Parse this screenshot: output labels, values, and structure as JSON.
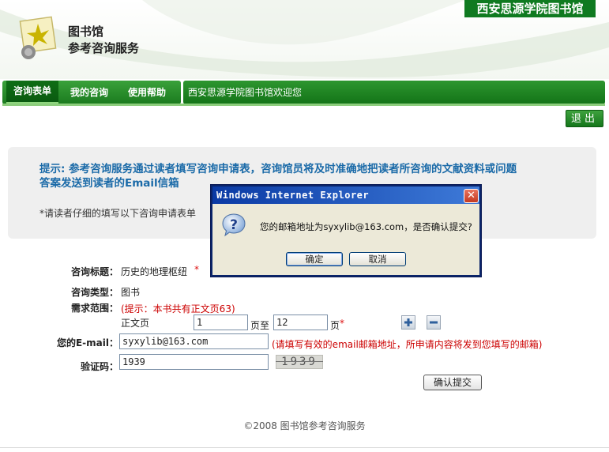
{
  "header": {
    "title": "图书馆",
    "subtitle": "参考咨询服务",
    "site_name": "西安思源学院图书馆"
  },
  "nav": {
    "items": [
      {
        "label": "咨询表单",
        "active": true
      },
      {
        "label": "我的咨询",
        "active": false
      },
      {
        "label": "使用帮助",
        "active": false
      }
    ],
    "welcome": "西安思源学院图书馆欢迎您",
    "logout_label": "退出"
  },
  "tip": {
    "line1": "提示: 参考咨询服务通过读者填写咨询申请表，咨询馆员将及时准确地把读者所咨询的文献资料或问题",
    "line2": "答案发送到读者的Email信箱",
    "instruction": "*请读者仔细的填写以下咨询申请表单"
  },
  "form": {
    "subject_label": "咨询标题：",
    "subject_value": "历史的地理枢纽",
    "type_label": "咨询类型：",
    "type_value": "图书",
    "range_label": "需求范围：",
    "range_note": "(提示：本书共有正文页63)",
    "body_pages_label": "正文页",
    "page_from": "1",
    "page_to_label": "页至",
    "page_to": "12",
    "page_suffix": "页",
    "email_label": "您的E-mail：",
    "email_value": "syxylib@163.com",
    "email_note": "(请填写有效的email邮箱地址，所申请内容将发到您填写的邮箱)",
    "captcha_label": "验证码：",
    "captcha_value": "1939",
    "captcha_image_text": "1939",
    "required_mark": "*",
    "submit_label": "确认提交"
  },
  "footer": {
    "text": "©2008 图书馆参考咨询服务"
  },
  "dialog": {
    "title": "Windows Internet Explorer",
    "close": "✕",
    "message": "您的邮箱地址为syxylib@163.com，是否确认提交?",
    "ok_label": "确定",
    "cancel_label": "取消"
  },
  "colors": {
    "brand_green": "#1a7a1e",
    "tip_blue": "#1a6aa8",
    "note_red": "#c00000",
    "dialog_blue": "#0a3aa4"
  },
  "icons": [
    "apple-logo-icon",
    "question-icon",
    "plus-icon",
    "minus-icon",
    "close-icon"
  ]
}
